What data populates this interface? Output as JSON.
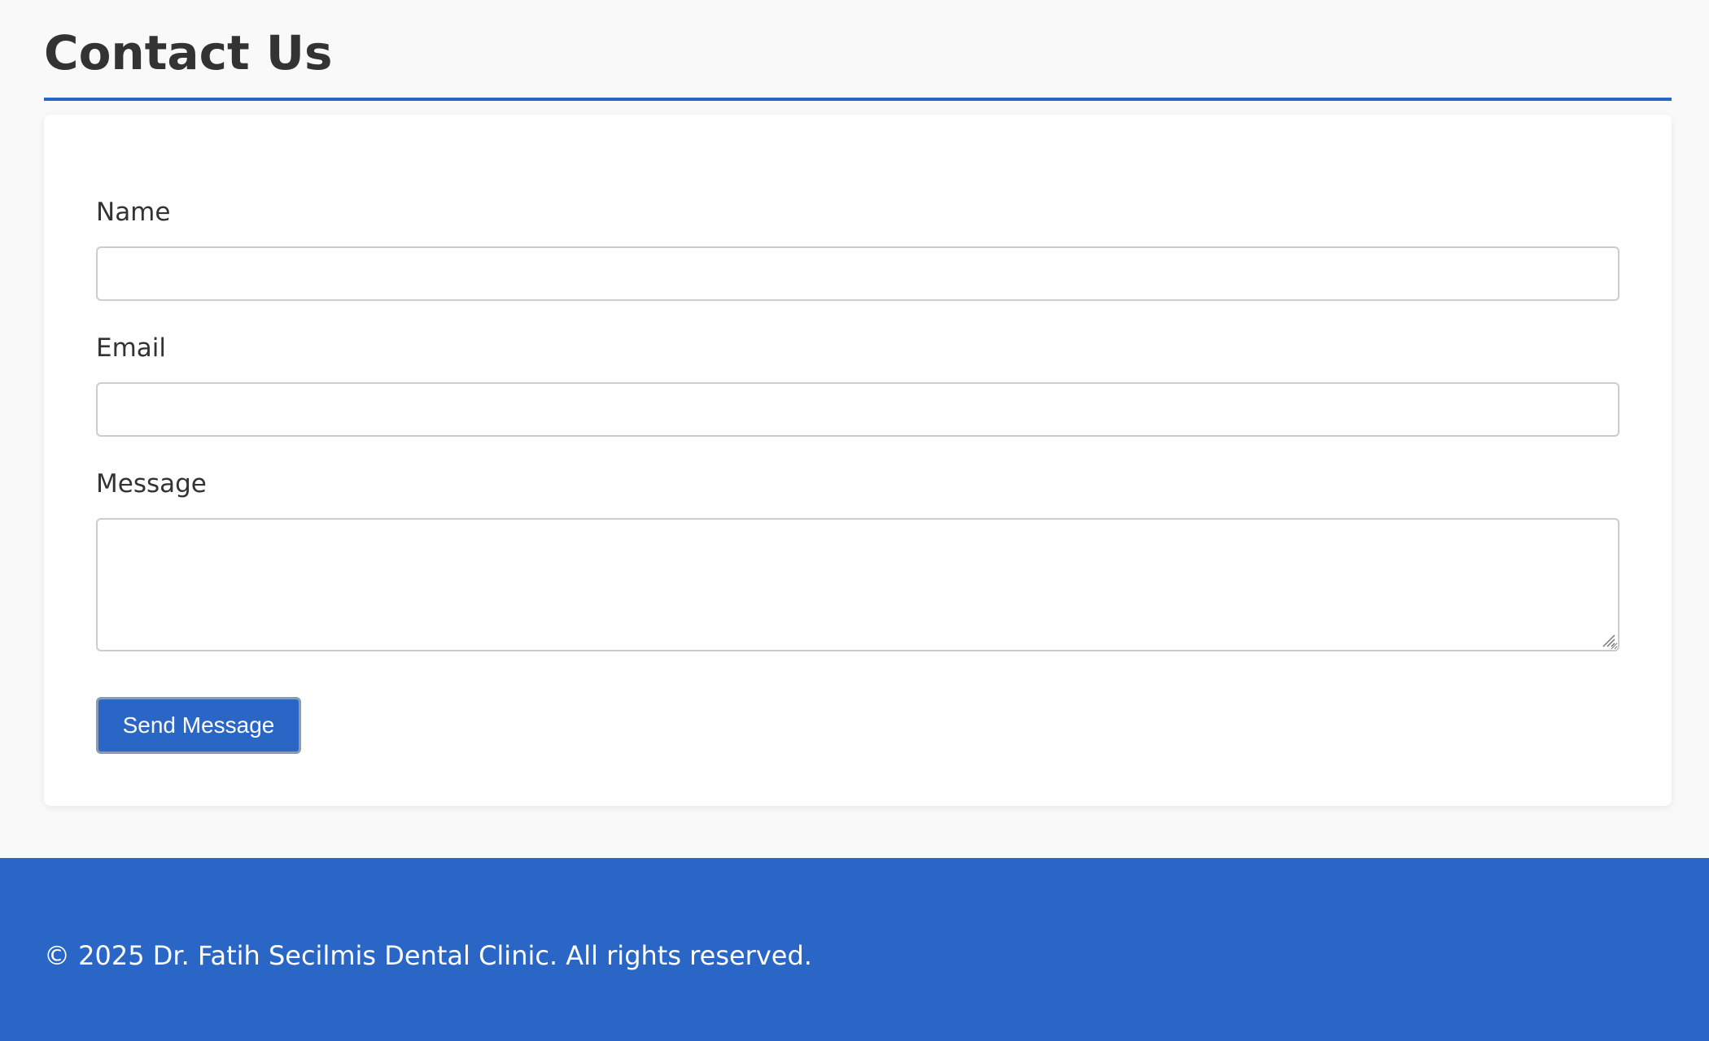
{
  "page": {
    "title": "Contact Us"
  },
  "form": {
    "name_label": "Name",
    "name_value": "",
    "email_label": "Email",
    "email_value": "",
    "message_label": "Message",
    "message_value": "",
    "submit_label": "Send Message"
  },
  "footer": {
    "copyright": "© 2025 Dr. Fatih Secilmis Dental Clinic. All rights reserved."
  },
  "colors": {
    "accent": "#2a66c6",
    "background": "#f9f9f9",
    "card": "#ffffff",
    "text": "#333333"
  },
  "icons": {
    "resize": "resize-grip-icon"
  }
}
